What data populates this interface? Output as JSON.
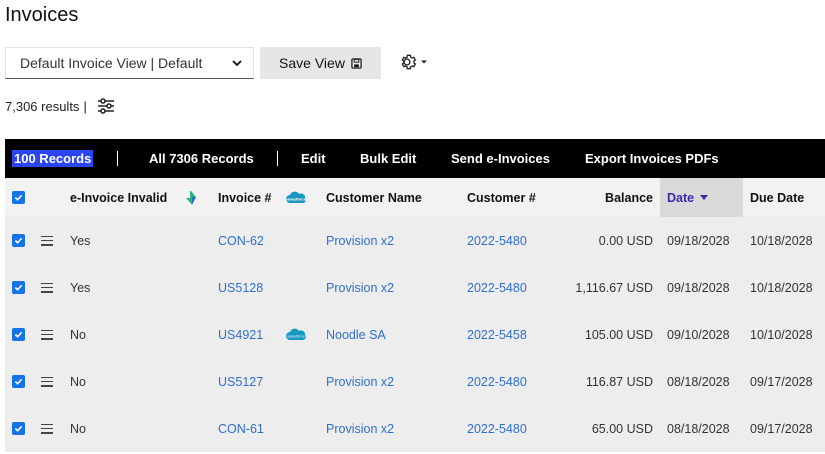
{
  "page": {
    "title": "Invoices"
  },
  "controls": {
    "view_select": "Default Invoice View | Default",
    "save_view": "Save View",
    "results": "7,306 results",
    "results_sep": "|"
  },
  "toolbar": {
    "selected_badge": "100  Records",
    "all_records": "All 7306 Records",
    "edit": "Edit",
    "bulk_edit": "Bulk Edit",
    "send_einvoices": "Send e-Invoices",
    "export_pdfs": "Export Invoices PDFs",
    "sep": "|"
  },
  "table": {
    "headers": {
      "einvoice_invalid": "e-Invoice Invalid",
      "invoice_no": "Invoice #",
      "customer_name": "Customer Name",
      "customer_no": "Customer #",
      "balance": "Balance",
      "date": "Date",
      "due_date": "Due Date"
    },
    "rows": [
      {
        "invalid": "Yes",
        "invoice": "CON-62",
        "salesforce": false,
        "customer": "Provision x2",
        "customer_no": "2022-5480",
        "balance": "0.00 USD",
        "date": "09/18/2028",
        "due": "10/18/2028"
      },
      {
        "invalid": "Yes",
        "invoice": "US5128",
        "salesforce": false,
        "customer": "Provision x2",
        "customer_no": "2022-5480",
        "balance": "1,116.67 USD",
        "date": "09/18/2028",
        "due": "10/18/2028"
      },
      {
        "invalid": "No",
        "invoice": "US4921",
        "salesforce": true,
        "customer": "Noodle SA",
        "customer_no": "2022-5458",
        "balance": "105.00 USD",
        "date": "09/10/2028",
        "due": "10/10/2028"
      },
      {
        "invalid": "No",
        "invoice": "US5127",
        "salesforce": false,
        "customer": "Provision x2",
        "customer_no": "2022-5480",
        "balance": "116.87 USD",
        "date": "08/18/2028",
        "due": "09/17/2028"
      },
      {
        "invalid": "No",
        "invoice": "CON-61",
        "salesforce": false,
        "customer": "Provision x2",
        "customer_no": "2022-5480",
        "balance": "65.00 USD",
        "date": "08/18/2028",
        "due": "09/17/2028"
      }
    ]
  },
  "colors": {
    "accent": "#1473e6",
    "badge": "#2b45f0",
    "link": "#2f6fd0",
    "date_header": "#3a2aa8",
    "salesforce": "#1798c1"
  },
  "icons": {
    "settings": "gear-icon",
    "filter": "sliders-icon",
    "save": "floppy-disk-icon",
    "salesforce": "salesforce-cloud-icon",
    "drag": "menu-icon"
  }
}
